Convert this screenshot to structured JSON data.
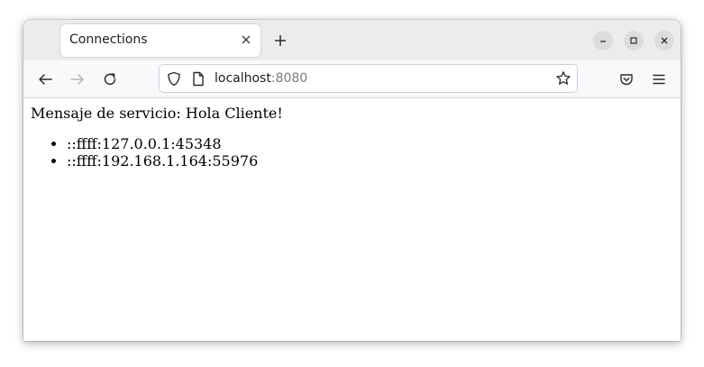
{
  "tab": {
    "title": "Connections"
  },
  "address_bar": {
    "host": "localhost",
    "port": ":8080"
  },
  "page": {
    "message": "Mensaje de servicio: Hola Cliente!",
    "connections": [
      "::ffff:127.0.0.1:45348",
      "::ffff:192.168.1.164:55976"
    ]
  },
  "icons": {
    "tab_close": "close-icon",
    "new_tab": "plus-icon",
    "minimize": "minimize-icon",
    "maximize": "maximize-icon",
    "close_window": "close-icon",
    "back": "arrow-left-icon",
    "forward": "arrow-right-icon",
    "reload": "reload-icon",
    "tracking": "shield-icon",
    "page": "page-icon",
    "bookmark": "star-icon",
    "pocket": "pocket-icon",
    "menu": "hamburger-menu-icon"
  },
  "colors": {
    "tabbar_bg": "#ececec",
    "navbar_bg": "#f9f9fb",
    "port_text": "#7a7a7a",
    "disabled_icon": "#b5b5b5"
  }
}
